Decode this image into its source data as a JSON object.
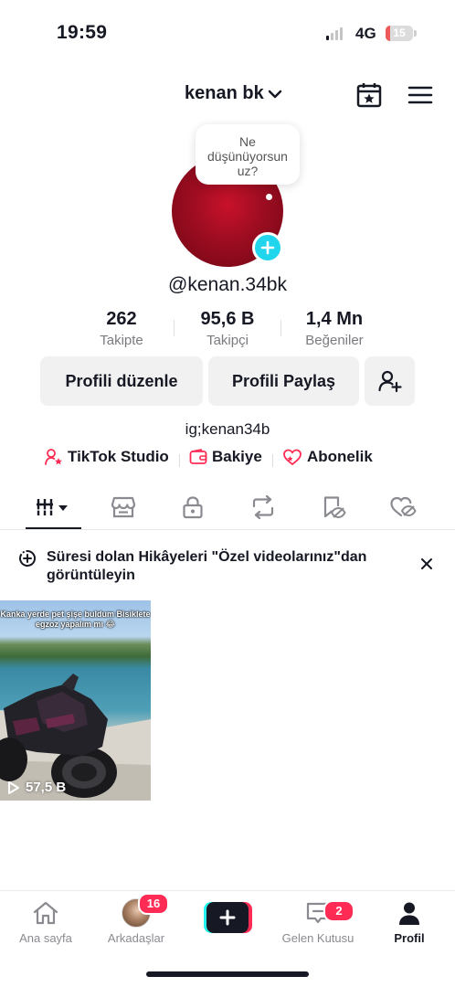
{
  "status_bar": {
    "time": "19:59",
    "network": "4G",
    "battery_level": "15",
    "battery_fraction": 0.15,
    "battery_color": "#ee5a5a"
  },
  "header": {
    "username": "kenan bk",
    "icons": [
      "calendar-star-icon",
      "menu-icon"
    ]
  },
  "profile": {
    "note_bubble": "Ne düşünüyorsun uz?",
    "handle": "@kenan.34bk",
    "bio": "ig;kenan34b"
  },
  "stats": [
    {
      "value": "262",
      "label": "Takipte"
    },
    {
      "value": "95,6 B",
      "label": "Takipçi"
    },
    {
      "value": "1,4 Mn",
      "label": "Beğeniler"
    }
  ],
  "buttons": {
    "edit": "Profili düzenle",
    "share": "Profili Paylaş"
  },
  "links": [
    {
      "label": "TikTok Studio",
      "icon": "person-star-icon"
    },
    {
      "label": "Bakiye",
      "icon": "wallet-icon"
    },
    {
      "label": "Abonelik",
      "icon": "heart-stars-icon"
    }
  ],
  "tabs": [
    "videos-grid-icon",
    "shop-icon",
    "lock-icon",
    "repost-icon",
    "bookmark-eye-icon",
    "liked-hidden-icon"
  ],
  "notice": {
    "text": "Süresi dolan Hikâyeleri \"Özel videolarınız\"dan görüntüleyin"
  },
  "videos": [
    {
      "caption": "Kanka yerde pet şişe buldum Bisiklete egzoz yapalım mı 😂",
      "views": "57,5 B"
    }
  ],
  "bottom_nav": {
    "home": "Ana sayfa",
    "friends": "Arkadaşlar",
    "friends_badge": "16",
    "inbox": "Gelen Kutusu",
    "inbox_badge": "2",
    "profile": "Profil"
  },
  "colors": {
    "accent": "#fe2c55",
    "cyan": "#20d5ec",
    "text": "#161823"
  }
}
